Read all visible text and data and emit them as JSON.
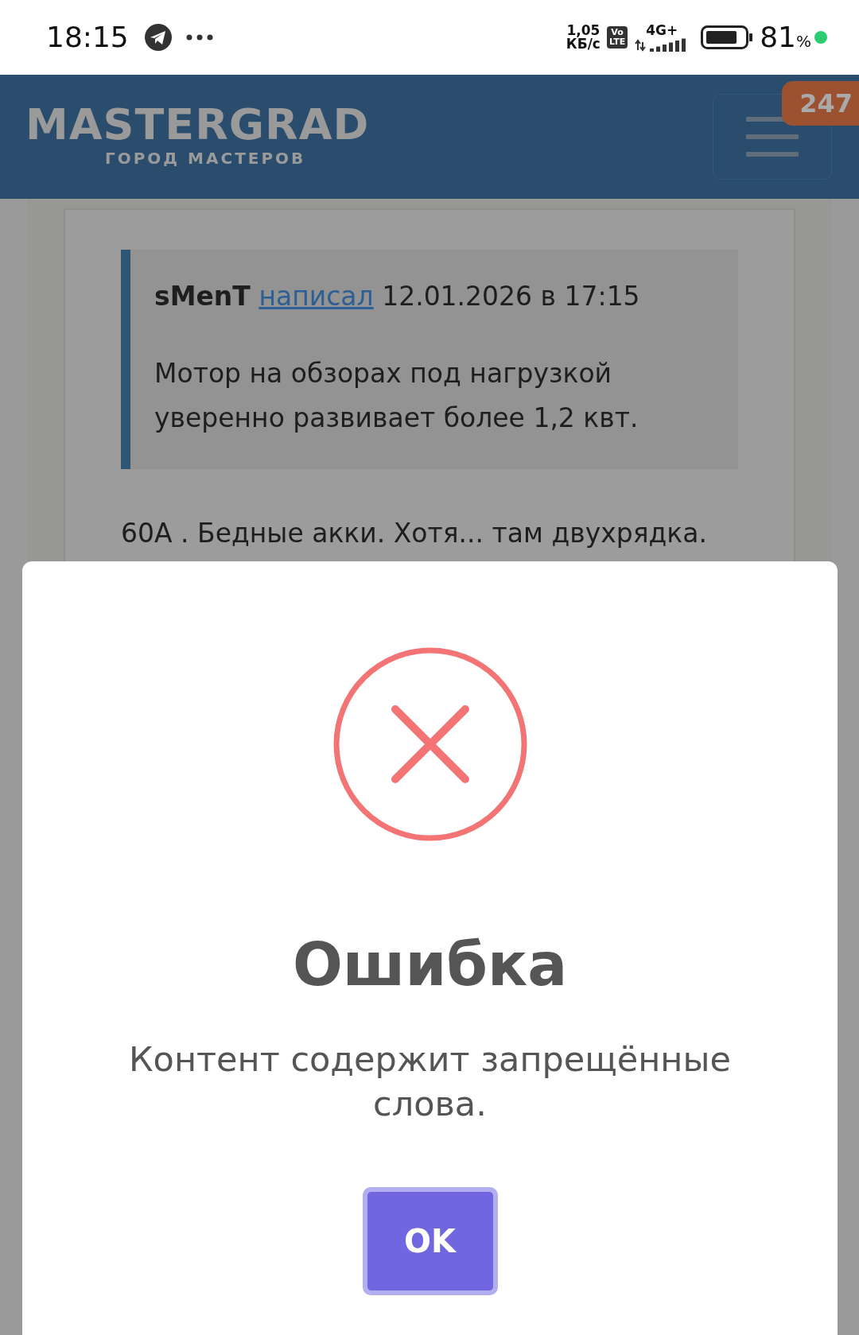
{
  "status_bar": {
    "time": "18:15",
    "net_speed": [
      "1,05",
      "КБ/с"
    ],
    "volte": [
      "Vo",
      "LTE"
    ],
    "network": "4G+",
    "battery": "81",
    "battery_unit": "%"
  },
  "header": {
    "logo": "MASTERGRAD",
    "tagline": "ГОРОД МАСТЕРОВ",
    "badge": "247"
  },
  "post": {
    "quote": {
      "author": "sMenT",
      "link": "написал",
      "date": "12.01.2026 в 17:15",
      "text": "Мотор на обзорах под нагрузкой уверенно развивает более 1,2 квт."
    },
    "text": "60А . Бедные акки. Хотя... там двухрядка."
  },
  "dialog": {
    "title": "Ошибка",
    "message": "Контент содержит запрещённые слова.",
    "button": "OK"
  }
}
